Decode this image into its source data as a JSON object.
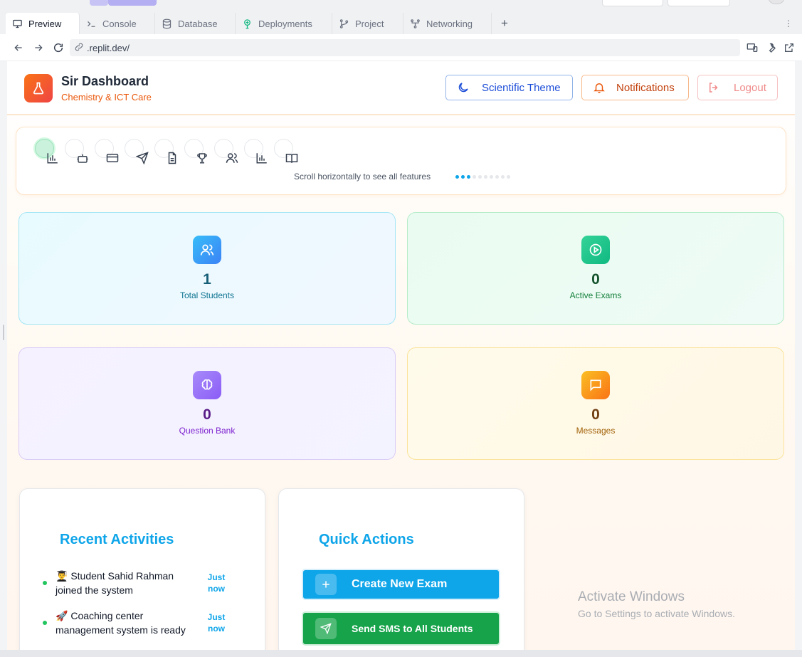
{
  "browser": {
    "tabs": [
      {
        "label": "Preview",
        "icon": "monitor-icon"
      },
      {
        "label": "Console",
        "icon": "terminal-icon"
      },
      {
        "label": "Database",
        "icon": "database-icon"
      },
      {
        "label": "Deployments",
        "icon": "deploy-icon"
      },
      {
        "label": "Project",
        "icon": "git-branch-icon"
      },
      {
        "label": "Networking",
        "icon": "network-icon"
      }
    ],
    "new_tab": "+",
    "url": ".replit.dev/"
  },
  "header": {
    "title": "Sir Dashboard",
    "subtitle": "Chemistry & ICT Care",
    "theme_button": "Scientific Theme",
    "notifications_button": "Notifications",
    "logout_button": "Logout"
  },
  "features": {
    "icons": [
      "bar-chart-icon",
      "robot-icon",
      "credit-card-icon",
      "send-icon",
      "document-icon",
      "trophy-icon",
      "users-icon",
      "bar-chart-icon",
      "book-icon"
    ],
    "hint": "Scroll horizontally to see all features"
  },
  "stats": [
    {
      "value": "1",
      "label": "Total Students"
    },
    {
      "value": "0",
      "label": "Active Exams"
    },
    {
      "value": "0",
      "label": "Question Bank"
    },
    {
      "value": "0",
      "label": "Messages"
    }
  ],
  "recent": {
    "title": "Recent Activities",
    "items": [
      {
        "emoji": "👨‍🎓",
        "text": "Student Sahid Rahman joined the system",
        "time": "Just now"
      },
      {
        "emoji": "🚀",
        "text": "Coaching center management system is ready",
        "time": "Just now"
      }
    ]
  },
  "quick": {
    "title": "Quick Actions",
    "create_exam": "Create New Exam",
    "send_sms": "Send SMS to All Students"
  },
  "watermark": {
    "line1": "Activate Windows",
    "line2": "Go to Settings to activate Windows."
  }
}
